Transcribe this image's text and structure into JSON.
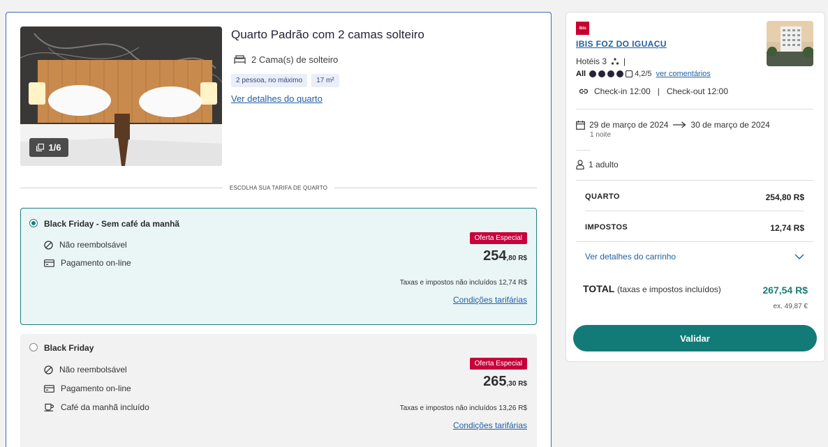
{
  "room": {
    "title": "Quarto Padrão com 2 camas solteiro",
    "beds": "2 Cama(s) de solteiro",
    "tags": [
      "2 pessoa, no máximo",
      "17 m²"
    ],
    "details_link": "Ver detalhes do quarto",
    "photo_counter": "1/6"
  },
  "rates_heading": "ESCOLHA SUA TARIFA DE QUARTO",
  "rates": [
    {
      "name": "Black Friday - Sem café da manhã",
      "selected": true,
      "features": [
        {
          "icon": "no-refund-icon",
          "label": "Não reembolsável"
        },
        {
          "icon": "card-icon",
          "label": "Pagamento on-line"
        }
      ],
      "badge": "Oferta Especial",
      "price_int": "254",
      "price_dec": ",80 R$",
      "tax_note": "Taxas e impostos não incluídos 12,74 R$",
      "conditions": "Condições tarifárias"
    },
    {
      "name": "Black Friday",
      "selected": false,
      "features": [
        {
          "icon": "no-refund-icon",
          "label": "Não reembolsável"
        },
        {
          "icon": "card-icon",
          "label": "Pagamento on-line"
        },
        {
          "icon": "coffee-icon",
          "label": "Café da manhã incluído"
        }
      ],
      "badge": "Oferta Especial",
      "price_int": "265",
      "price_dec": ",30 R$",
      "tax_note": "Taxas e impostos não incluídos 13,26 R$",
      "conditions": "Condições tarifárias"
    }
  ],
  "summary": {
    "logo_text": "ibis",
    "hotel_name": "IBIS FOZ DO IGUAÇU",
    "category": "Hotéis 3",
    "category_sep": "|",
    "rating_brand": "All",
    "rating_score": "4,2/5",
    "rating_dots": 4,
    "reviews_link": "ver comentários",
    "checkin": "Check-in 12:00",
    "checkout": "Check-out 12:00",
    "check_sep": "|",
    "date_from": "29 de março de 2024",
    "date_to": "30 de março de 2024",
    "nights": "1 noite",
    "guests": "1 adulto",
    "room_label": "QUARTO",
    "room_value": "254,80 R$",
    "tax_label": "IMPOSTOS",
    "tax_value": "12,74 R$",
    "cart_details": "Ver detalhes do carrinho",
    "total_label": "TOTAL",
    "total_sub": "(taxas e impostos incluídos)",
    "total_value": "267,54 R$",
    "total_eur": "ex. 49,87 €",
    "validate": "Validar"
  },
  "colors": {
    "accent_teal": "#137b77",
    "offer_red": "#c8003c",
    "link_blue": "#1f5fa4",
    "selected_bg": "#eaf5f5"
  }
}
